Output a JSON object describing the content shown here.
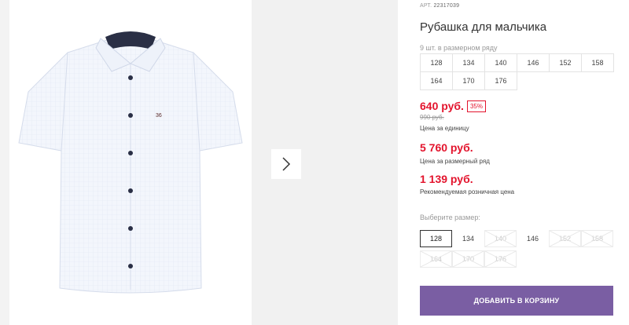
{
  "product": {
    "article_label": "АРТ.",
    "article_number": "22317039",
    "title": "Рубашка для мальчика",
    "pack_note": "9 шт. в размерном ряду"
  },
  "size_range": {
    "row1": [
      "128",
      "134",
      "140",
      "146",
      "152",
      "158"
    ],
    "row2": [
      "164",
      "170",
      "176"
    ]
  },
  "pricing": {
    "unit_price": "640 руб.",
    "discount": "35%",
    "old_price": "990 руб.",
    "unit_label": "Цена за единицу",
    "pack_price": "5 760 руб.",
    "pack_label": "Цена за размерный ряд",
    "rrp_price": "1 139 руб.",
    "rrp_label": "Рекомендуемая розничная цена"
  },
  "size_select": {
    "label": "Выберите размер:",
    "row1": [
      "128",
      "134",
      "140",
      "146",
      "152",
      "158"
    ],
    "row2": [
      "164",
      "170",
      "176"
    ],
    "selected": "128",
    "available": [
      "128",
      "134",
      "146"
    ]
  },
  "actions": {
    "add_to_cart": "ДОБАВИТЬ В КОРЗИНУ"
  },
  "colors": {
    "accent": "#7a5ea3",
    "price_red": "#e3142d"
  }
}
